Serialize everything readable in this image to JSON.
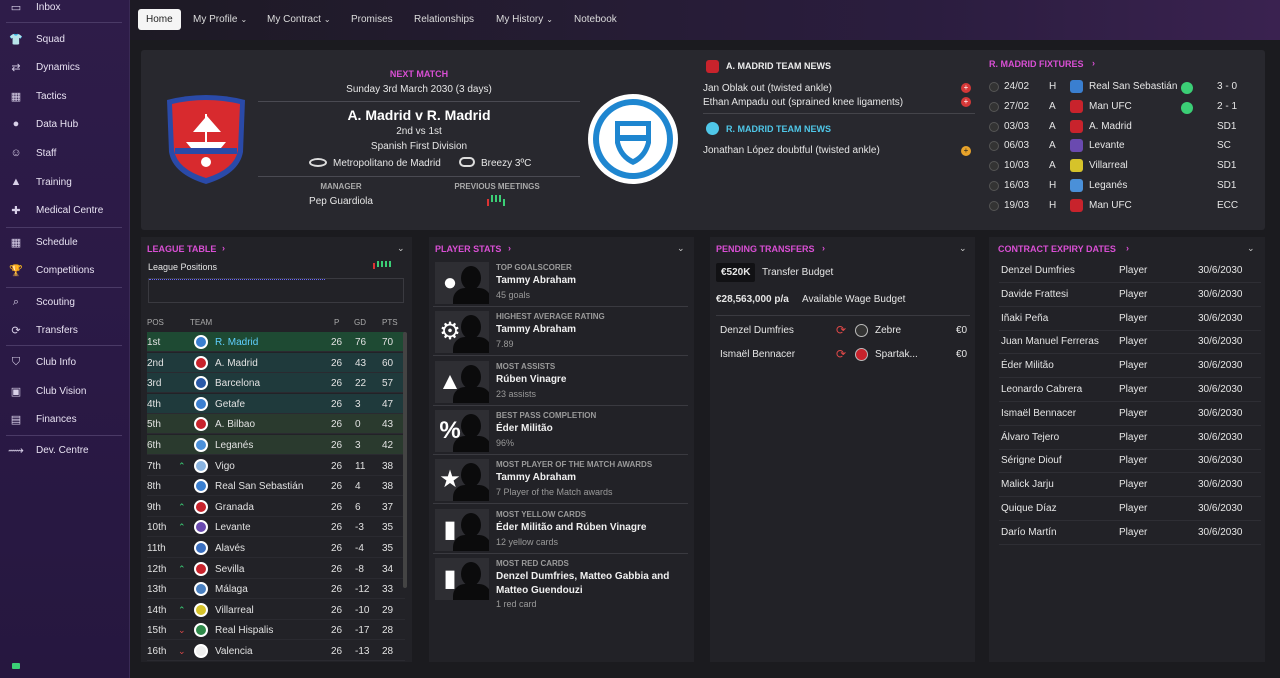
{
  "sidebar": {
    "items": [
      {
        "label": "Inbox",
        "icon": "inbox-icon"
      },
      {
        "label": "Squad",
        "icon": "shirt-icon"
      },
      {
        "label": "Dynamics",
        "icon": "dynamics-icon"
      },
      {
        "label": "Tactics",
        "icon": "tactics-board-icon"
      },
      {
        "label": "Data Hub",
        "icon": "data-hub-icon"
      },
      {
        "label": "Staff",
        "icon": "staff-icon"
      },
      {
        "label": "Training",
        "icon": "training-cone-icon"
      },
      {
        "label": "Medical Centre",
        "icon": "medical-kit-icon"
      },
      {
        "label": "Schedule",
        "icon": "calendar-icon"
      },
      {
        "label": "Competitions",
        "icon": "trophy-icon"
      },
      {
        "label": "Scouting",
        "icon": "magnifier-icon"
      },
      {
        "label": "Transfers",
        "icon": "transfer-arrows-icon"
      },
      {
        "label": "Club Info",
        "icon": "shield-icon"
      },
      {
        "label": "Club Vision",
        "icon": "briefcase-icon"
      },
      {
        "label": "Finances",
        "icon": "finances-icon"
      },
      {
        "label": "Dev. Centre",
        "icon": "dev-centre-icon"
      }
    ]
  },
  "tabs": [
    {
      "label": "Home"
    },
    {
      "label": "My Profile"
    },
    {
      "label": "My Contract"
    },
    {
      "label": "Promises"
    },
    {
      "label": "Relationships"
    },
    {
      "label": "My History"
    },
    {
      "label": "Notebook"
    }
  ],
  "next_match": {
    "title": "NEXT MATCH",
    "date": "Sunday 3rd March 2030 (3 days)",
    "fixture": "A. Madrid v R. Madrid",
    "positions": "2nd vs 1st",
    "competition": "Spanish First Division",
    "stadium": "Metropolitano de Madrid",
    "weather": "Breezy 3ºC",
    "manager_label": "MANAGER",
    "manager": "Pep Guardiola",
    "prev_label": "PREVIOUS MEETINGS"
  },
  "team_news": {
    "a_title": "A. MADRID TEAM NEWS",
    "a_items": [
      "Jan Oblak out (twisted ankle)",
      "Ethan Ampadu out (sprained knee ligaments)"
    ],
    "r_title": "R. MADRID TEAM NEWS",
    "r_items": [
      "Jonathan López doubtful (twisted ankle)"
    ]
  },
  "fixtures": {
    "title": "R. MADRID FIXTURES",
    "rows": [
      {
        "date": "24/02",
        "ha": "H",
        "team": "Real San Sebastián",
        "res": "3 - 0",
        "color": "#3a7fd0",
        "win": true
      },
      {
        "date": "27/02",
        "ha": "A",
        "team": "Man UFC",
        "res": "2 - 1",
        "color": "#c8232c",
        "win": true
      },
      {
        "date": "03/03",
        "ha": "A",
        "team": "A. Madrid",
        "res": "SD1",
        "color": "#c8232c",
        "win": false
      },
      {
        "date": "06/03",
        "ha": "A",
        "team": "Levante",
        "res": "SC",
        "color": "#6a4ab0",
        "win": false
      },
      {
        "date": "10/03",
        "ha": "A",
        "team": "Villarreal",
        "res": "SD1",
        "color": "#d6c32a",
        "win": false
      },
      {
        "date": "16/03",
        "ha": "H",
        "team": "Leganés",
        "res": "SD1",
        "color": "#4a90d9",
        "win": false
      },
      {
        "date": "19/03",
        "ha": "H",
        "team": "Man UFC",
        "res": "ECC",
        "color": "#c8232c",
        "win": false
      }
    ]
  },
  "league": {
    "title": "LEAGUE TABLE",
    "positions_label": "League Positions",
    "headers": {
      "pos": "POS",
      "team": "TEAM",
      "p": "P",
      "gd": "GD",
      "pts": "PTS"
    },
    "rows": [
      {
        "pos": "1st",
        "team": "R. Madrid",
        "p": "26",
        "gd": "76",
        "pts": "70",
        "trend": "",
        "color": "#3a7fd0"
      },
      {
        "pos": "2nd",
        "team": "A. Madrid",
        "p": "26",
        "gd": "43",
        "pts": "60",
        "trend": "",
        "color": "#c8232c"
      },
      {
        "pos": "3rd",
        "team": "Barcelona",
        "p": "26",
        "gd": "22",
        "pts": "57",
        "trend": "",
        "color": "#2a5aa8"
      },
      {
        "pos": "4th",
        "team": "Getafe",
        "p": "26",
        "gd": "3",
        "pts": "47",
        "trend": "",
        "color": "#3a7fd0"
      },
      {
        "pos": "5th",
        "team": "A. Bilbao",
        "p": "26",
        "gd": "0",
        "pts": "43",
        "trend": "",
        "color": "#c8232c"
      },
      {
        "pos": "6th",
        "team": "Leganés",
        "p": "26",
        "gd": "3",
        "pts": "42",
        "trend": "",
        "color": "#4a90d9"
      },
      {
        "pos": "7th",
        "team": "Vigo",
        "p": "26",
        "gd": "11",
        "pts": "38",
        "trend": "^",
        "color": "#8ab4e0"
      },
      {
        "pos": "8th",
        "team": "Real San Sebastián",
        "p": "26",
        "gd": "4",
        "pts": "38",
        "trend": "",
        "color": "#3a7fd0"
      },
      {
        "pos": "9th",
        "team": "Granada",
        "p": "26",
        "gd": "6",
        "pts": "37",
        "trend": "^",
        "color": "#c8232c"
      },
      {
        "pos": "10th",
        "team": "Levante",
        "p": "26",
        "gd": "-3",
        "pts": "35",
        "trend": "^",
        "color": "#6a4ab0"
      },
      {
        "pos": "11th",
        "team": "Alavés",
        "p": "26",
        "gd": "-4",
        "pts": "35",
        "trend": "",
        "color": "#3a6fc0"
      },
      {
        "pos": "12th",
        "team": "Sevilla",
        "p": "26",
        "gd": "-8",
        "pts": "34",
        "trend": "^",
        "color": "#c8232c"
      },
      {
        "pos": "13th",
        "team": "Málaga",
        "p": "26",
        "gd": "-12",
        "pts": "33",
        "trend": "",
        "color": "#4a80c0"
      },
      {
        "pos": "14th",
        "team": "Villarreal",
        "p": "26",
        "gd": "-10",
        "pts": "29",
        "trend": "^",
        "color": "#d6c32a"
      },
      {
        "pos": "15th",
        "team": "Real Hispalis",
        "p": "26",
        "gd": "-17",
        "pts": "28",
        "trend": "v",
        "color": "#2f8a4a"
      },
      {
        "pos": "16th",
        "team": "Valencia",
        "p": "26",
        "gd": "-13",
        "pts": "28",
        "trend": "v",
        "color": "#eeeeee"
      }
    ]
  },
  "player_stats": {
    "title": "PLAYER STATS",
    "rows": [
      {
        "label": "TOP GOALSCORER",
        "name": "Tammy Abraham",
        "sub": "45 goals",
        "icon": "football-icon"
      },
      {
        "label": "HIGHEST AVERAGE RATING",
        "name": "Tammy Abraham",
        "sub": "7.89",
        "icon": "rating-gear-icon"
      },
      {
        "label": "MOST ASSISTS",
        "name": "Rúben Vinagre",
        "sub": "23 assists",
        "icon": "assist-icon"
      },
      {
        "label": "BEST PASS COMPLETION",
        "name": "Éder Militão",
        "sub": "96%",
        "icon": "percent-icon"
      },
      {
        "label": "MOST PLAYER OF THE MATCH AWARDS",
        "name": "Tammy Abraham",
        "sub": "7 Player of the Match awards",
        "icon": "star-icon"
      },
      {
        "label": "MOST YELLOW CARDS",
        "name": "Éder Militão and Rúben Vinagre",
        "sub": "12 yellow cards",
        "icon": "card-icon"
      },
      {
        "label": "MOST RED CARDS",
        "name": "Denzel Dumfries, Matteo Gabbia and Matteo Guendouzi",
        "sub": "1 red card",
        "icon": "card-icon"
      }
    ]
  },
  "transfers": {
    "title": "PENDING TRANSFERS",
    "budget": "€520K",
    "budget_label": "Transfer Budget",
    "wage": "€28,563,000 p/a",
    "wage_label": "Available Wage Budget",
    "rows": [
      {
        "player": "Denzel Dumfries",
        "club": "Zebre",
        "fee": "€0"
      },
      {
        "player": "Ismaël Bennacer",
        "club": "Spartak...",
        "fee": "€0"
      }
    ]
  },
  "contracts": {
    "title": "CONTRACT EXPIRY DATES",
    "rows": [
      {
        "name": "Denzel Dumfries",
        "role": "Player",
        "date": "30/6/2030"
      },
      {
        "name": "Davide Frattesi",
        "role": "Player",
        "date": "30/6/2030"
      },
      {
        "name": "Iñaki Peña",
        "role": "Player",
        "date": "30/6/2030"
      },
      {
        "name": "Juan Manuel Ferreras",
        "role": "Player",
        "date": "30/6/2030"
      },
      {
        "name": "Éder Militão",
        "role": "Player",
        "date": "30/6/2030"
      },
      {
        "name": "Leonardo Cabrera",
        "role": "Player",
        "date": "30/6/2030"
      },
      {
        "name": "Ismaël Bennacer",
        "role": "Player",
        "date": "30/6/2030"
      },
      {
        "name": "Álvaro Tejero",
        "role": "Player",
        "date": "30/6/2030"
      },
      {
        "name": "Sérigne Diouf",
        "role": "Player",
        "date": "30/6/2030"
      },
      {
        "name": "Malick Jarju",
        "role": "Player",
        "date": "30/6/2030"
      },
      {
        "name": "Quique Díaz",
        "role": "Player",
        "date": "30/6/2030"
      },
      {
        "name": "Darío Martín",
        "role": "Player",
        "date": "30/6/2030"
      }
    ]
  }
}
